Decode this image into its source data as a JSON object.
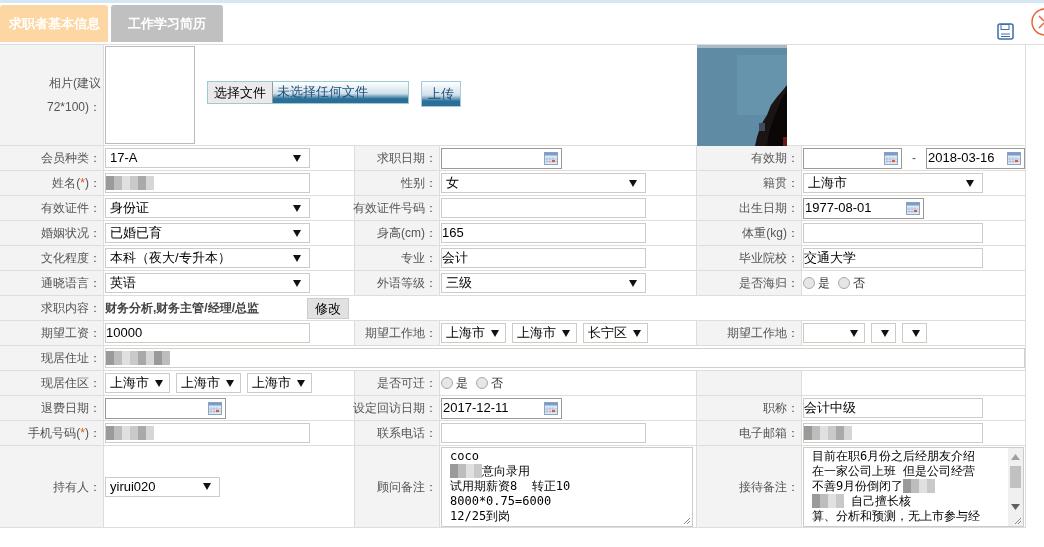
{
  "tabs": [
    {
      "label": "求职者基本信息",
      "selected": true
    },
    {
      "label": "工作学习简历",
      "selected": false
    }
  ],
  "photo": {
    "label": "相片(建议72*100)：",
    "file_button": "选择文件",
    "file_status": "未选择任何文件",
    "upload_button": "上传"
  },
  "rows": [
    {
      "kind": "triple",
      "pairs": [
        {
          "label": "会员种类：",
          "controls": [
            {
              "kind": "select",
              "value": "17-A"
            }
          ]
        },
        {
          "label": "求职日期：",
          "controls": [
            {
              "kind": "date"
            }
          ]
        },
        {
          "label": "有效期：",
          "controls": [
            {
              "kind": "date"
            },
            {
              "kind": "dash",
              "text": "-"
            },
            {
              "kind": "date",
              "value": "2018-03-16"
            }
          ]
        }
      ]
    },
    {
      "kind": "triple",
      "pairs": [
        {
          "label": "姓名(",
          "req": "*",
          "label_tail": ")：",
          "controls": [
            {
              "kind": "input",
              "blurred": true
            }
          ]
        },
        {
          "label": "性别：",
          "controls": [
            {
              "kind": "select",
              "value": "女"
            }
          ]
        },
        {
          "label": "籍贯：",
          "controls": [
            {
              "kind": "select",
              "value": "上海市"
            }
          ]
        }
      ]
    },
    {
      "kind": "triple",
      "pairs": [
        {
          "label": "有效证件：",
          "controls": [
            {
              "kind": "select",
              "value": "身份证"
            }
          ]
        },
        {
          "label": "有效证件号码：",
          "controls": [
            {
              "kind": "input",
              "blurred": false
            }
          ]
        },
        {
          "label": "出生日期：",
          "controls": [
            {
              "kind": "date",
              "value": "1977-08-01"
            }
          ]
        }
      ]
    },
    {
      "kind": "triple",
      "pairs": [
        {
          "label": "婚姻状况：",
          "controls": [
            {
              "kind": "select",
              "value": "已婚已育"
            }
          ]
        },
        {
          "label": "身高(cm)：",
          "controls": [
            {
              "kind": "input",
              "value": "165",
              "blurred": false
            }
          ]
        },
        {
          "label": "体重(kg)：",
          "controls": [
            {
              "kind": "input",
              "blurred": false
            }
          ]
        }
      ]
    },
    {
      "kind": "triple",
      "pairs": [
        {
          "label": "文化程度：",
          "controls": [
            {
              "kind": "select",
              "value": "本科（夜大/专升本）"
            }
          ]
        },
        {
          "label": "专业：",
          "controls": [
            {
              "kind": "input",
              "value": "会计",
              "blurred": false
            }
          ]
        },
        {
          "label": "毕业院校：",
          "controls": [
            {
              "kind": "input",
              "value": "交通大学",
              "blurred": false
            }
          ]
        }
      ]
    },
    {
      "kind": "triple",
      "pairs": [
        {
          "label": "通晓语言：",
          "controls": [
            {
              "kind": "select",
              "value": "英语"
            }
          ]
        },
        {
          "label": "外语等级：",
          "controls": [
            {
              "kind": "select",
              "value": "三级"
            }
          ]
        },
        {
          "label": "是否海归：",
          "controls": [
            {
              "kind": "radio",
              "options": [
                {
                  "label": "是",
                  "selected": false
                },
                {
                  "label": "否",
                  "selected": false
                }
              ]
            }
          ]
        }
      ]
    },
    {
      "kind": "single",
      "pairs": [
        {
          "label": "求职内容：",
          "controls": [
            {
              "kind": "text",
              "value": "财务分析,财务主管/经理/总监"
            },
            {
              "kind": "button",
              "label": "修改"
            }
          ]
        }
      ]
    },
    {
      "kind": "triple",
      "pairs": [
        {
          "label": "期望工资：",
          "controls": [
            {
              "kind": "input",
              "value": "10000",
              "blurred": false
            }
          ]
        },
        {
          "label": "期望工作地：",
          "controls": [
            {
              "kind": "mini_select",
              "value": "上海市"
            },
            {
              "kind": "mini_select",
              "value": "上海市"
            },
            {
              "kind": "mini_select",
              "value": "长宁区"
            }
          ]
        },
        {
          "label": "期望工作地：",
          "controls": [
            {
              "kind": "mini_select"
            },
            {
              "kind": "mini_select"
            },
            {
              "kind": "mini_select"
            }
          ]
        }
      ]
    },
    {
      "kind": "single",
      "pairs": [
        {
          "label": "现居住址：",
          "controls": [
            {
              "kind": "wide_input",
              "blurred": true
            }
          ]
        }
      ]
    },
    {
      "kind": "triple",
      "pairs": [
        {
          "label": "现居住区：",
          "controls": [
            {
              "kind": "mini_select",
              "value": "上海市"
            },
            {
              "kind": "mini_select",
              "value": "上海市"
            },
            {
              "kind": "mini_select",
              "value": "上海市"
            }
          ]
        },
        {
          "label": "是否可迁：",
          "controls": [
            {
              "kind": "radio",
              "options": [
                {
                  "label": "是",
                  "selected": false
                },
                {
                  "label": "否",
                  "selected": false
                }
              ]
            }
          ]
        }
      ]
    },
    {
      "kind": "triple",
      "pairs": [
        {
          "label": "退费日期：",
          "controls": [
            {
              "kind": "date"
            }
          ]
        },
        {
          "label": "设定回访日期：",
          "controls": [
            {
              "kind": "date",
              "value": "2017-12-11"
            }
          ]
        },
        {
          "label": "职称：",
          "controls": [
            {
              "kind": "input",
              "value": "会计中级",
              "blurred": false
            }
          ]
        }
      ]
    },
    {
      "kind": "triple",
      "pairs": [
        {
          "label": "手机号码(",
          "req": "*",
          "label_tail": ")：",
          "controls": [
            {
              "kind": "input",
              "blurred": true
            }
          ]
        },
        {
          "label": "联系电话：",
          "controls": [
            {
              "kind": "input",
              "blurred": false
            }
          ]
        },
        {
          "label": "电子邮箱：",
          "controls": [
            {
              "kind": "input",
              "blurred": true
            }
          ]
        }
      ]
    },
    {
      "kind": "notes",
      "pairs": [
        {
          "label": "持有人：",
          "controls": [
            {
              "kind": "short_select",
              "value": "yirui020"
            }
          ]
        },
        {
          "label": "顾问备注：",
          "controls": [
            {
              "kind": "textarea",
              "scrollbar": false,
              "lines": [
                [
                  {
                    "kind": "text",
                    "text": "coco"
                  }
                ],
                [
                  {
                    "kind": "blur"
                  },
                  {
                    "kind": "text",
                    "text": "意向录用"
                  }
                ],
                [
                  {
                    "kind": "text",
                    "text": "试用期薪资8  转正10"
                  }
                ],
                [
                  {
                    "kind": "text",
                    "text": "8000*0.75=6000"
                  }
                ],
                [
                  {
                    "kind": "text",
                    "text": "12/25到岗"
                  }
                ]
              ]
            }
          ]
        },
        {
          "label": "接待备注：",
          "controls": [
            {
              "kind": "textarea",
              "scrollbar": true,
              "lines": [
                [
                  {
                    "kind": "text",
                    "text": "目前在职6月份之后经朋友介绍"
                  }
                ],
                [
                  {
                    "kind": "text",
                    "text": "在一家公司上班 但是公司经营"
                  }
                ],
                [
                  {
                    "kind": "text",
                    "text": "不善9月份倒闭了"
                  },
                  {
                    "kind": "blur"
                  }
                ],
                [
                  {
                    "kind": "blur"
                  },
                  {
                    "kind": "text",
                    "text": " 自己擅长核"
                  }
                ],
                [
                  {
                    "kind": "text",
                    "text": "算、分析和预测，无上市参与经"
                  }
                ]
              ]
            }
          ]
        }
      ]
    }
  ]
}
